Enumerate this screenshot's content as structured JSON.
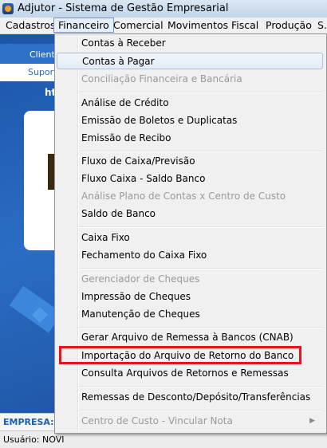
{
  "window": {
    "title": "Adjutor - Sistema de Gestão Empresarial"
  },
  "menubar": {
    "items": [
      {
        "label": "Cadastros"
      },
      {
        "label": "Financeiro"
      },
      {
        "label": "Comercial"
      },
      {
        "label": "Movimentos"
      },
      {
        "label": "Fiscal"
      },
      {
        "label": "Produção"
      },
      {
        "label": "S.I"
      }
    ],
    "active": "Financeiro"
  },
  "background": {
    "cliente_label": "Cliente",
    "suporte_label": "Suport",
    "ht_label": "ht",
    "empresa_label": "EMPRESA:"
  },
  "statusbar": {
    "user": "Usuário: NOVI"
  },
  "financeiro_menu": {
    "items": [
      {
        "label": "Contas à Receber"
      },
      {
        "label": "Contas à Pagar"
      },
      {
        "label": "Conciliação Financeira e Bancária"
      },
      {
        "label": "Análise de Crédito"
      },
      {
        "label": "Emissão de Boletos e Duplicatas"
      },
      {
        "label": "Emissão de Recibo"
      },
      {
        "label": "Fluxo de Caixa/Previsão"
      },
      {
        "label": "Fluxo Caixa - Saldo Banco"
      },
      {
        "label": "Análise Plano de Contas x Centro de Custo"
      },
      {
        "label": "Saldo de Banco"
      },
      {
        "label": "Caixa Fixo"
      },
      {
        "label": "Fechamento do Caixa Fixo"
      },
      {
        "label": "Gerenciador de Cheques"
      },
      {
        "label": "Impressão de Cheques"
      },
      {
        "label": "Manutenção de Cheques"
      },
      {
        "label": "Gerar Arquivo de Remessa à Bancos (CNAB)"
      },
      {
        "label": "Importação  do Arquivo de Retorno do Banco"
      },
      {
        "label": "Consulta Arquivos de Retornos e Remessas"
      },
      {
        "label": "Remessas de Desconto/Depósito/Transferências"
      },
      {
        "label": "Centro de Custo - Vincular Nota"
      }
    ],
    "submenu_arrow": "▶"
  },
  "colors": {
    "highlight_box": "#e8141b",
    "accent_blue": "#2a6cc4"
  }
}
